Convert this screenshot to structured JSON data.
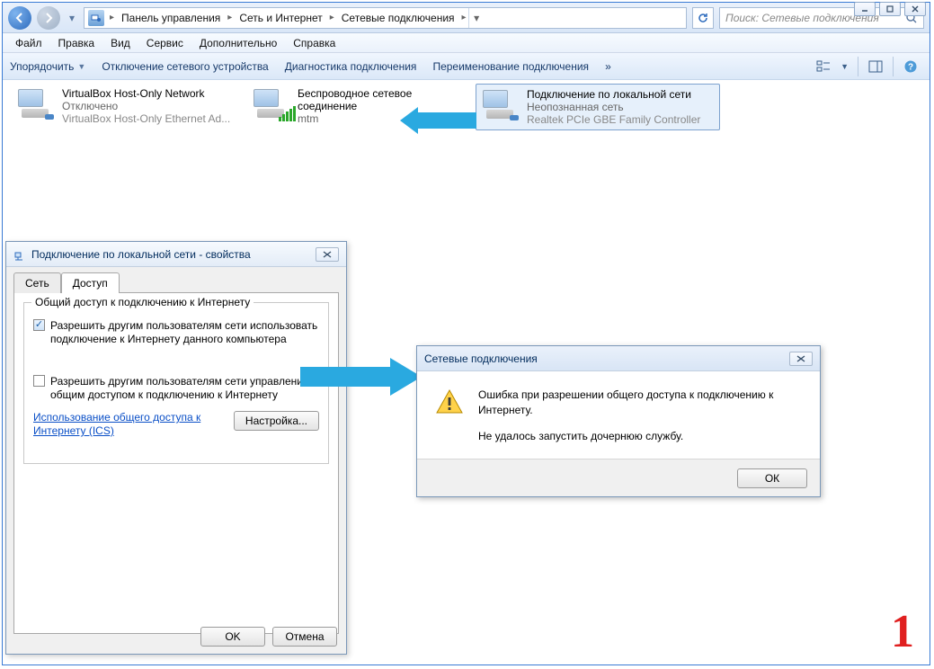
{
  "window_controls": {
    "min": "minimize",
    "max": "maximize",
    "close": "close"
  },
  "breadcrumbs": {
    "root_icon": "network-adapter",
    "items": [
      "Панель управления",
      "Сеть и Интернет",
      "Сетевые подключения"
    ]
  },
  "search": {
    "placeholder": "Поиск: Сетевые подключения"
  },
  "menubar": {
    "file": "Файл",
    "edit": "Правка",
    "view": "Вид",
    "service": "Сервис",
    "extra": "Дополнительно",
    "help": "Справка"
  },
  "toolbar": {
    "organize": "Упорядочить",
    "disable": "Отключение сетевого устройства",
    "diagnose": "Диагностика подключения",
    "rename": "Переименование подключения",
    "overflow": "»"
  },
  "connections": [
    {
      "name": "VirtualBox Host-Only Network",
      "status": "Отключено",
      "device": "VirtualBox Host-Only Ethernet Ad..."
    },
    {
      "name": "Беспроводное сетевое",
      "name2": "соединение",
      "status": "mtm",
      "device": ""
    },
    {
      "name": "Подключение по локальной сети",
      "status": "Неопознанная сеть",
      "device": "Realtek PCIe GBE Family Controller"
    }
  ],
  "props_dialog": {
    "title": "Подключение по локальной сети - свойства",
    "tab_network": "Сеть",
    "tab_sharing": "Доступ",
    "group_title": "Общий доступ к подключению к Интернету",
    "chk1": "Разрешить другим пользователям сети использовать подключение к Интернету данного компьютера",
    "chk2": "Разрешить другим пользователям сети управление общим доступом к подключению к Интернету",
    "link_line1": "Использование общего доступа к",
    "link_line2": "Интернету (ICS)",
    "settings_btn": "Настройка...",
    "ok": "OK",
    "cancel": "Отмена"
  },
  "error_dialog": {
    "title": "Сетевые подключения",
    "line1": "Ошибка при разрешении общего доступа к подключению к Интернету.",
    "line2": "Не удалось запустить дочернюю службу.",
    "ok": "ОК"
  },
  "annotation_number": "1"
}
